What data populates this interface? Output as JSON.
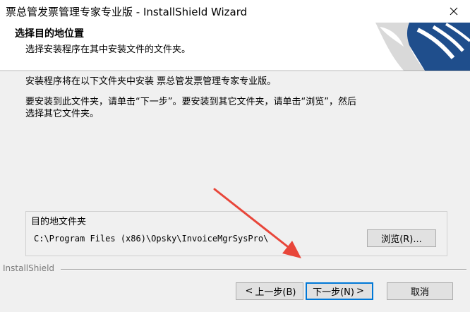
{
  "window": {
    "title": "票总管发票管理专家专业版 - InstallShield Wizard"
  },
  "header": {
    "title": "选择目的地位置",
    "subtitle": "选择安装程序在其中安装文件的文件夹。"
  },
  "body": {
    "line1": "安装程序将在以下文件夹中安装 票总管发票管理专家专业版。",
    "line2": "要安装到此文件夹，请单击“下一步”。要安装到其它文件夹，请单击“浏览”，然后",
    "line3": "选择其它文件夹。"
  },
  "destination": {
    "group_label": "目的地文件夹",
    "path": "C:\\Program Files (x86)\\Opsky\\InvoiceMgrSysPro\\",
    "browse_label": "浏览(R)..."
  },
  "footer": {
    "brand": "InstallShield",
    "back_label": "上一步(B)",
    "back_chevron": "<",
    "next_label": "下一步(N)",
    "next_chevron": ">",
    "cancel_label": "取消"
  },
  "colors": {
    "accent_border": "#0078d7",
    "annotation_arrow": "#e8463a",
    "logo_blue": "#1f4e8c"
  },
  "icons": [
    "close-icon",
    "installshield-logo",
    "annotation-arrow"
  ]
}
